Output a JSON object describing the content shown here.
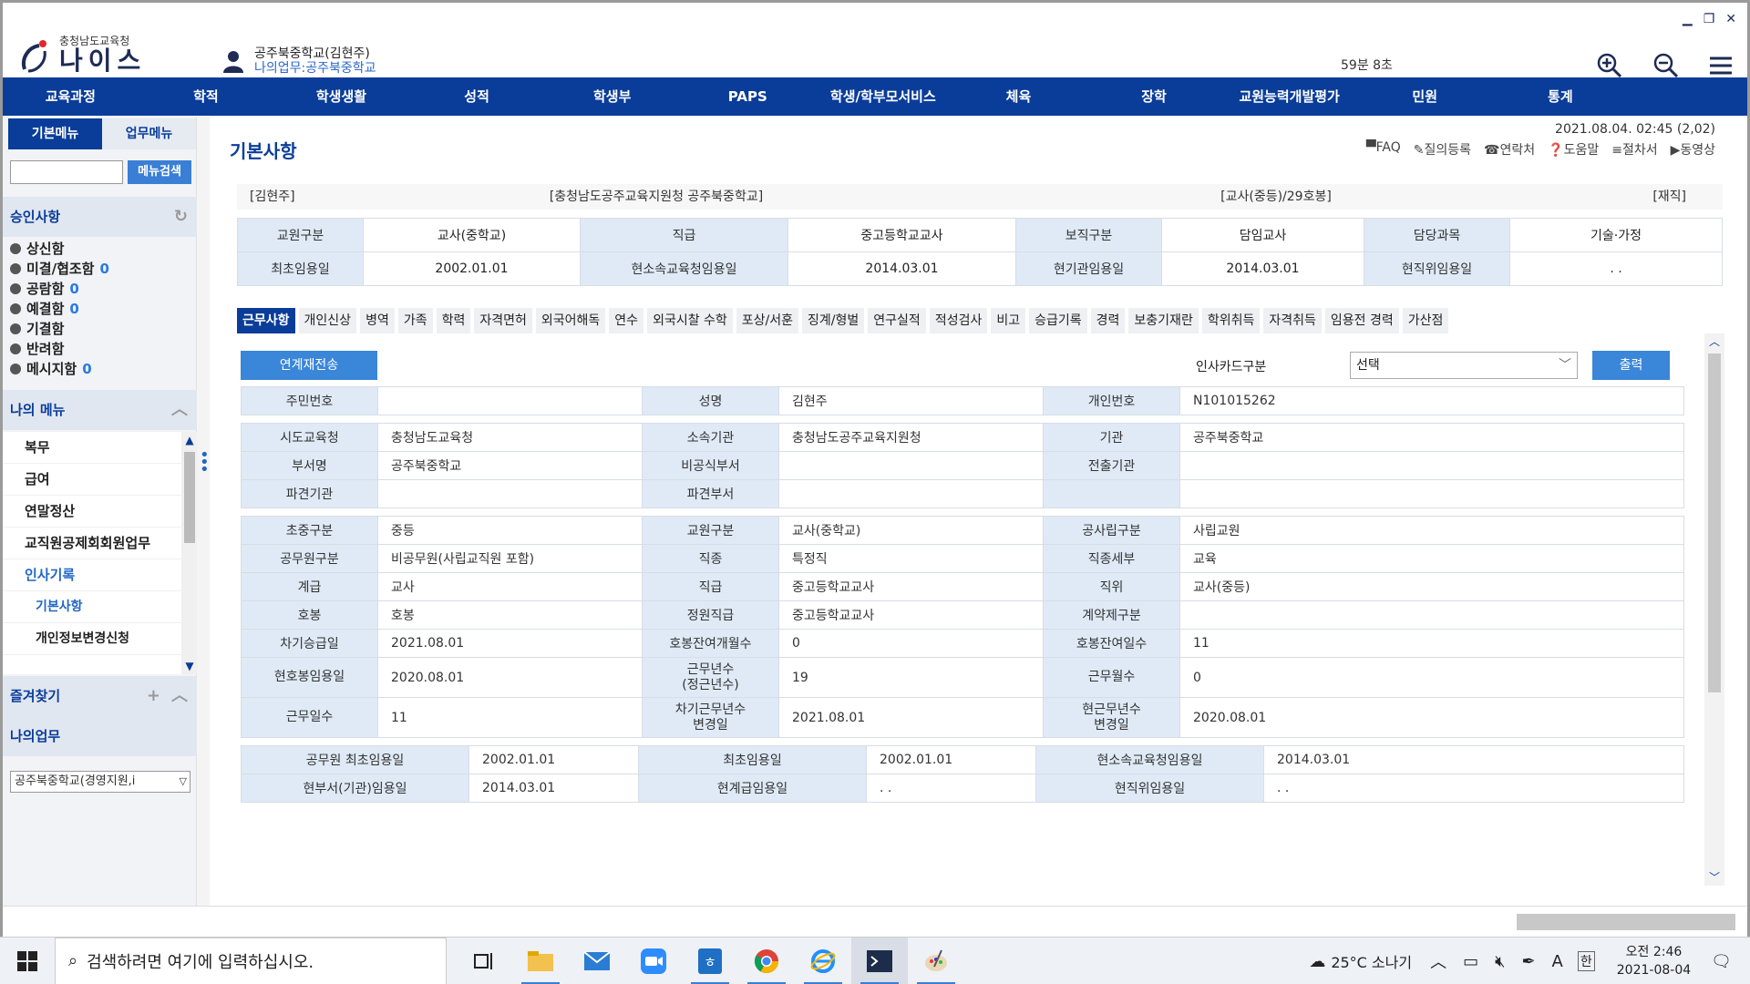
{
  "header": {
    "logo_sub": "충청남도교육청",
    "logo_main": "나이스",
    "user_name": "공주북중학교(김현주)",
    "user_dept": "나의업무:공주북중학교",
    "session_time": "59분 8초"
  },
  "topnav": [
    "교육과정",
    "학적",
    "학생생활",
    "성적",
    "학생부",
    "PAPS",
    "학생/학부모서비스",
    "체육",
    "장학",
    "교원능력개발평가",
    "민원",
    "통계"
  ],
  "left": {
    "tab_basic": "기본메뉴",
    "tab_work": "업무메뉴",
    "search_btn": "메뉴검색",
    "approval_title": "승인사항",
    "approval": [
      {
        "label": "상신함",
        "count": ""
      },
      {
        "label": "미결/협조함",
        "count": "0"
      },
      {
        "label": "공람함",
        "count": "0"
      },
      {
        "label": "예결함",
        "count": "0"
      },
      {
        "label": "기결함",
        "count": ""
      },
      {
        "label": "반려함",
        "count": ""
      },
      {
        "label": "메시지함",
        "count": "0"
      }
    ],
    "mymenu_title": "나의 메뉴",
    "mymenu": [
      "복무",
      "급여",
      "연말정산",
      "교직원공제회회원업무",
      "인사기록"
    ],
    "mymenu_sub": [
      "기본사항",
      "개인정보변경신청"
    ],
    "favorites_title": "즐겨찾기",
    "mywork_title": "나의업무",
    "workplace": "공주북중학교(경영지원,i"
  },
  "main": {
    "title": "기본사항",
    "datetime": "2021.08.04. 02:45 (2,02)",
    "help": [
      "FAQ",
      "질의등록",
      "연락처",
      "도움말",
      "절차서",
      "동영상"
    ],
    "info_head": [
      "[김현주]",
      "[충청남도공주교육지원청 공주북중학교]",
      "[교사(중등)/29호봉]",
      "[재직]"
    ],
    "info_row1": [
      "교원구분",
      "교사(중학교)",
      "직급",
      "중고등학교교사",
      "보직구분",
      "담임교사",
      "담당과목",
      "기술·가정"
    ],
    "info_row2": [
      "최초임용일",
      "2002.01.01",
      "현소속교육청임용일",
      "2014.03.01",
      "현기관임용일",
      "2014.03.01",
      "현직위임용일",
      ". ."
    ],
    "tabs": [
      "근무사항",
      "개인신상",
      "병역",
      "가족",
      "학력",
      "자격면허",
      "외국어해독",
      "연수",
      "외국시찰 수학",
      "포상/서훈",
      "징계/형벌",
      "연구실적",
      "적성검사",
      "비고",
      "승급기록",
      "경력",
      "보충기재란",
      "학위취득",
      "자격취득",
      "임용전 경력",
      "가산점"
    ],
    "resend_btn": "연계재전송",
    "card_label": "인사카드구분",
    "card_select": "선택",
    "print_btn": "출력",
    "block1": [
      [
        "주민번호",
        "",
        "성명",
        "김현주",
        "개인번호",
        "N101015262"
      ]
    ],
    "block2": [
      [
        "시도교육청",
        "충청남도교육청",
        "소속기관",
        "충청남도공주교육지원청",
        "기관",
        "공주북중학교"
      ],
      [
        "부서명",
        "공주북중학교",
        "비공식부서",
        "",
        "전출기관",
        ""
      ],
      [
        "파견기관",
        "",
        "파견부서",
        "",
        "",
        ""
      ]
    ],
    "block3": [
      [
        "초중구분",
        "중등",
        "교원구분",
        "교사(중학교)",
        "공사립구분",
        "사립교원"
      ],
      [
        "공무원구분",
        "비공무원(사립교직원 포함)",
        "직종",
        "특정직",
        "직종세부",
        "교육"
      ],
      [
        "계급",
        "교사",
        "직급",
        "중고등학교교사",
        "직위",
        "교사(중등)"
      ],
      [
        "호봉",
        "  호봉",
        "정원직급",
        "중고등학교교사",
        "계약제구분",
        ""
      ],
      [
        "차기승급일",
        "2021.08.01",
        "호봉잔여개월수",
        "0",
        "호봉잔여일수",
        "11"
      ],
      [
        "현호봉임용일",
        "2020.08.01",
        "근무년수\n(정근년수)",
        "19",
        "근무월수",
        "0"
      ],
      [
        "근무일수",
        "11",
        "차기근무년수\n변경일",
        "2021.08.01",
        "현근무년수\n변경일",
        "2020.08.01"
      ]
    ],
    "block4": [
      [
        "공무원 최초임용일",
        "2002.01.01",
        "최초임용일",
        "2002.01.01",
        "현소속교육청임용일",
        "2014.03.01"
      ],
      [
        "현부서(기관)임용일",
        "2014.03.01",
        "현계급임용일",
        ". .",
        "현직위임용일",
        ". ."
      ]
    ]
  },
  "taskbar": {
    "search_placeholder": "검색하려면 여기에 입력하십시오.",
    "weather": "25°C  소나기",
    "ime": "A",
    "lang": "한",
    "time": "오전 2:46",
    "date": "2021-08-04"
  }
}
